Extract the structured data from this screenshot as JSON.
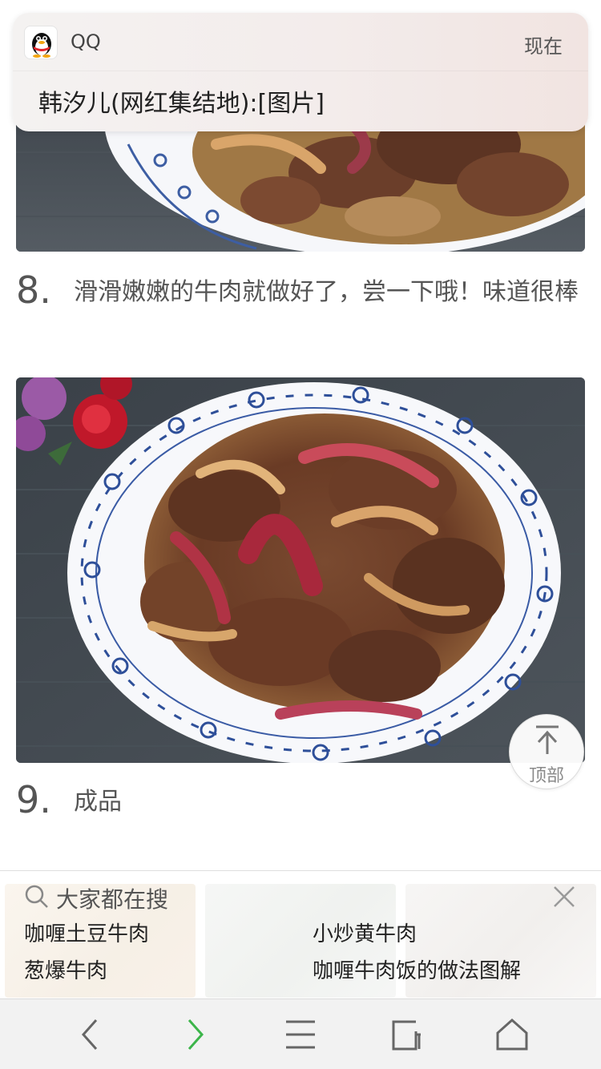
{
  "notification": {
    "app_name": "QQ",
    "time": "现在",
    "message": "韩汐儿(网红集结地):[图片]"
  },
  "steps": [
    {
      "number": "8.",
      "text": "滑滑嫩嫩的牛肉就做好了，尝一下哦！味道很棒"
    },
    {
      "number": "9.",
      "text": "成品"
    }
  ],
  "back_to_top": {
    "label": "顶部"
  },
  "suggestions": {
    "title": "大家都在搜",
    "keywords": [
      "咖喱土豆牛肉",
      "小炒黄牛肉",
      "葱爆牛肉",
      "咖喱牛肉饭的做法图解"
    ]
  },
  "toolbar": {
    "icons": [
      "back-icon",
      "forward-icon",
      "menu-icon",
      "tabs-icon",
      "home-icon"
    ]
  },
  "colors": {
    "accent_green": "#3cb54a",
    "text": "#555555",
    "toolbar_bg": "#f2f2f2"
  }
}
